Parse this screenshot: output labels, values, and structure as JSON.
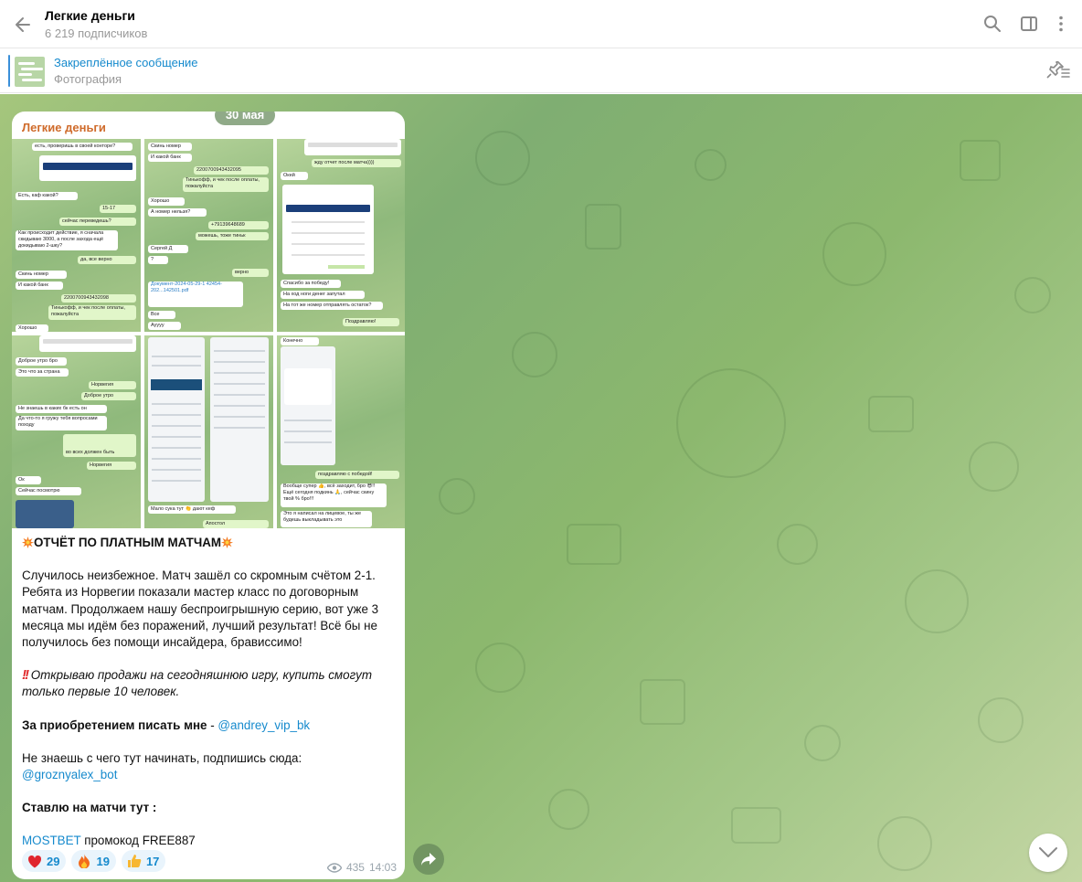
{
  "header": {
    "title": "Легкие деньги",
    "subscribers": "6 219 подписчиков"
  },
  "pinned": {
    "title": "Закреплённое сообщение",
    "subtitle": "Фотография"
  },
  "chat": {
    "date_pill": "30 мая"
  },
  "post": {
    "sender": "Легкие деньги",
    "screenshots": {
      "s1": [
        "есть, проверишь в своей конторе?",
        "Есть, каф какой?",
        "15-17",
        "сейчас переведешь?",
        "Как происходит действие, я сначала скидываю 3000, а после захода ещё докидываю 2-шку?",
        "да, все верно",
        "Скинь номер",
        "И какой банк",
        "2200700943432098",
        "Тинькофф, и чек после оплаты, пожалуйста",
        "Хорошо"
      ],
      "s2": [
        "Скинь номер",
        "И какой банк",
        "2200700943432095",
        "Тинькофф, и чек после оплаты, пожалуйста",
        "Хорошо",
        "А номер нельзя?",
        "+79139648689",
        "можешь, тоже тиньк",
        "Сергей Д",
        "?",
        "верно",
        "Документ-2024-05-29-1 42454-202...142501.pdf",
        "Все",
        "Ауууу"
      ],
      "s3": [
        "жду отчет после матча))))",
        "Окей",
        "Спасибо за победу!",
        "На ход ноги денег запутал",
        "На тот же номер отправлять остаток?",
        "Поздравляю!"
      ],
      "s4": [
        "Доброе утро бро",
        "Это что за страна",
        "Норвегия",
        "Доброе утро",
        "Не знаешь в каких бк есть он",
        "Да что-то я гружу тебя вопросами походу",
        "во всех должен быть",
        "Норвегия",
        "Ок",
        "Сейчас посмотрю"
      ],
      "s5": [
        "Мало сука тут 👏 дают кеф",
        "Апостол"
      ],
      "s6": [
        "Конечно",
        "поздравляю с победой!",
        "Вообще супер 👍, всё заходит, бро 😎!!Ещё сегодня подкинь 🙏, сейчас скину твой % бро!!!",
        "Это я написал на лицевое, ты же будешь выкладывать это"
      ]
    },
    "headline": "ОТЧЁТ ПО ПЛАТНЫМ МАТЧАМ",
    "paragraph1": "Случилось неизбежное. Матч зашёл со скромным счётом 2-1. Ребята из Норвегии показали мастер класс по договорным матчам. Продолжаем нашу беспроигрышную серию, вот уже 3 месяца мы идём без поражений, лучший результат! Всё бы не получилось без помощи инсайдера, брависсимо!",
    "paragraph2": "Открываю продажи на сегодняшнюю игру, купить смогут только первые 10 человек.",
    "contact_label": "За приобретением писать мне",
    "contact_sep": " - ",
    "contact_link": "@andrey_vip_bk",
    "start_label": "Не знаешь с чего тут начинать, подпишись сюда:",
    "start_link": "@groznyalex_bot",
    "bets_label": "Ставлю на матчи тут :",
    "mostbet_link": "MOSTBET",
    "promo_text": " промокод FREE887",
    "reactions": [
      {
        "emoji": "heart-icon",
        "count": "29"
      },
      {
        "emoji": "fire-icon",
        "count": "19"
      },
      {
        "emoji": "thumbs-up-icon",
        "count": "17"
      }
    ],
    "views": "435",
    "time": "14:03"
  },
  "colors": {
    "accent": "#168acd",
    "sender": "#cf6b2b",
    "reaction_bg": "#e9f4fc"
  }
}
